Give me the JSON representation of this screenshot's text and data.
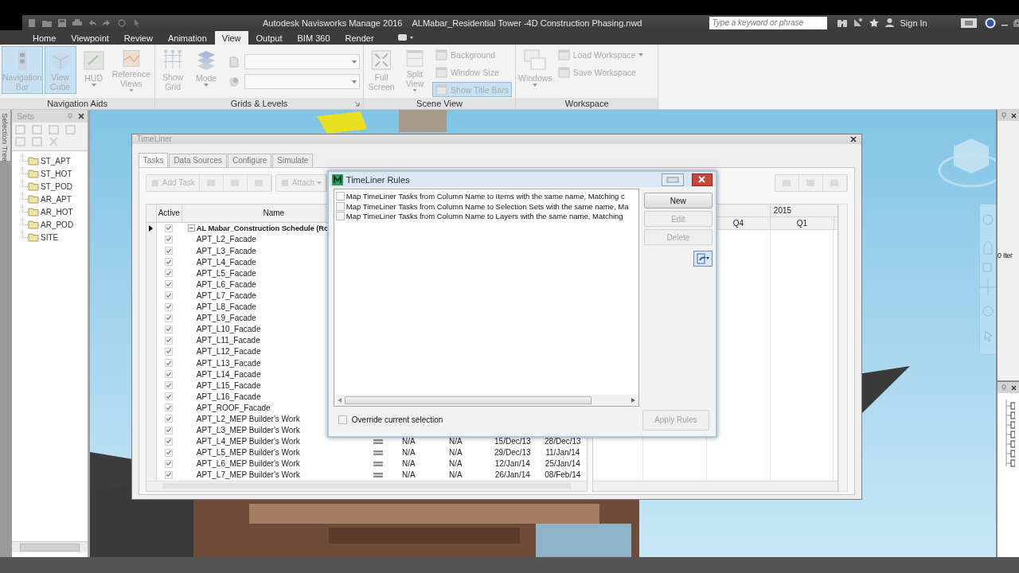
{
  "app": {
    "title": "Autodesk Navisworks Manage 2016",
    "document": "ALMabar_Residential Tower -4D Construction Phasing.nwd",
    "search": {
      "placeholder": "Type a keyword or phrase"
    },
    "sign_in": "Sign In"
  },
  "ribbon_tabs": [
    {
      "label": "Home",
      "selected": false
    },
    {
      "label": "Viewpoint",
      "selected": false
    },
    {
      "label": "Review",
      "selected": false
    },
    {
      "label": "Animation",
      "selected": false
    },
    {
      "label": "View",
      "selected": true
    },
    {
      "label": "Output",
      "selected": false
    },
    {
      "label": "BIM 360",
      "selected": false
    },
    {
      "label": "Render",
      "selected": false
    }
  ],
  "ribbon": {
    "disabled": true,
    "groups": [
      {
        "label": "Navigation Aids",
        "launcher": false,
        "items": [
          {
            "kind": "large",
            "label": "Navigation Bar",
            "on": true,
            "dropdown": false
          },
          {
            "kind": "large",
            "label": "View Cube",
            "on": true,
            "dropdown": false
          },
          {
            "kind": "large",
            "label": "HUD",
            "on": false,
            "dropdown": true
          },
          {
            "kind": "large",
            "label": "Reference Views",
            "on": false,
            "dropdown": true
          }
        ]
      },
      {
        "label": "Grids & Levels",
        "launcher": true,
        "items": [
          {
            "kind": "large",
            "label": "Show Grid",
            "on": false,
            "dropdown": false
          },
          {
            "kind": "large",
            "label": "Mode",
            "on": false,
            "dropdown": true
          },
          {
            "kind": "combos"
          }
        ]
      },
      {
        "label": "Scene View",
        "launcher": false,
        "items": [
          {
            "kind": "large",
            "label": "Full Screen",
            "on": false,
            "dropdown": false
          },
          {
            "kind": "large",
            "label": "Split View",
            "on": false,
            "dropdown": true
          },
          {
            "kind": "stack",
            "items": [
              {
                "label": "Background",
                "on": false,
                "dropdown": false
              },
              {
                "label": "Window Size",
                "on": false,
                "dropdown": false
              },
              {
                "label": "Show Title Bars",
                "on": true,
                "dropdown": false
              }
            ]
          }
        ]
      },
      {
        "label": "Workspace",
        "launcher": false,
        "items": [
          {
            "kind": "large",
            "label": "Windows",
            "on": false,
            "dropdown": true
          },
          {
            "kind": "stack",
            "items": [
              {
                "label": "Load Workspace",
                "on": false,
                "dropdown": true
              },
              {
                "label": "Save Workspace",
                "on": false,
                "dropdown": false
              }
            ]
          }
        ]
      }
    ]
  },
  "sets_panel": {
    "tab": "Selection Tree",
    "title": "Sets",
    "items": [
      "ST_APT",
      "ST_HOT",
      "ST_POD",
      "AR_APT",
      "AR_HOT",
      "AR_POD",
      "SITE"
    ]
  },
  "timeliner": {
    "title": "TimeLiner",
    "tabs": [
      {
        "label": "Tasks",
        "selected": true
      },
      {
        "label": "Data Sources",
        "selected": false
      },
      {
        "label": "Configure",
        "selected": false
      },
      {
        "label": "Simulate",
        "selected": false
      }
    ],
    "toolbar": [
      {
        "label": "Add Task",
        "disabled": true
      },
      {
        "label": "Attach",
        "disabled": true
      }
    ],
    "columns": [
      "Active",
      "Name"
    ],
    "rows": [
      {
        "kind": "group",
        "name": "AL Mabar_Construction Schedule (Ro",
        "active": true,
        "selected": true,
        "expanded": true
      },
      {
        "kind": "task",
        "name": "APT_L2_Facade",
        "active": true,
        "selected": false
      },
      {
        "kind": "task",
        "name": "APT_L3_Facade",
        "active": true,
        "selected": false
      },
      {
        "kind": "task",
        "name": "APT_L4_Facade",
        "active": true,
        "selected": false
      },
      {
        "kind": "task",
        "name": "APT_L5_Facade",
        "active": true,
        "selected": false
      },
      {
        "kind": "task",
        "name": "APT_L6_Facade",
        "active": true,
        "selected": false
      },
      {
        "kind": "task",
        "name": "APT_L7_Facade",
        "active": true,
        "selected": false
      },
      {
        "kind": "task",
        "name": "APT_L8_Facade",
        "active": true,
        "selected": false
      },
      {
        "kind": "task",
        "name": "APT_L9_Facade",
        "active": true,
        "selected": false
      },
      {
        "kind": "task",
        "name": "APT_L10_Facade",
        "active": true,
        "selected": false
      },
      {
        "kind": "task",
        "name": "APT_L11_Facade",
        "active": true,
        "selected": false
      },
      {
        "kind": "task",
        "name": "APT_L12_Facade",
        "active": true,
        "selected": false
      },
      {
        "kind": "task",
        "name": "APT_L13_Facade",
        "active": true,
        "selected": false
      },
      {
        "kind": "task",
        "name": "APT_L14_Facade",
        "active": true,
        "selected": false
      },
      {
        "kind": "task",
        "name": "APT_L15_Facade",
        "active": true,
        "selected": false
      },
      {
        "kind": "task",
        "name": "APT_L16_Facade",
        "active": true,
        "selected": false
      },
      {
        "kind": "task",
        "name": "APT_ROOF_Facade",
        "active": true,
        "selected": false
      },
      {
        "kind": "task",
        "name": "APT_L2_MEP Builder's Work",
        "active": true,
        "selected": false
      },
      {
        "kind": "task",
        "name": "APT_L3_MEP Builder's Work",
        "active": true,
        "selected": false
      },
      {
        "kind": "task",
        "name": "APT_L4_MEP Builder's Work",
        "active": true,
        "selected": false,
        "cells": [
          "N/A",
          "N/A",
          "15/Dec/13",
          "28/Dec/13"
        ]
      },
      {
        "kind": "task",
        "name": "APT_L5_MEP Builder's Work",
        "active": true,
        "selected": false,
        "cells": [
          "N/A",
          "N/A",
          "29/Dec/13",
          "11/Jan/14"
        ]
      },
      {
        "kind": "task",
        "name": "APT_L6_MEP Builder's Work",
        "active": true,
        "selected": false,
        "cells": [
          "N/A",
          "N/A",
          "12/Jan/14",
          "25/Jan/14"
        ]
      },
      {
        "kind": "task",
        "name": "APT_L7_MEP Builder's Work",
        "active": true,
        "selected": false,
        "cells": [
          "N/A",
          "N/A",
          "26/Jan/14",
          "08/Feb/14"
        ]
      }
    ],
    "gantt": {
      "year": "2015",
      "quarters": [
        "Q4",
        "Q1"
      ]
    }
  },
  "rules_dialog": {
    "title": "TimeLiner Rules",
    "rules": [
      {
        "text": "Map TimeLiner Tasks from Column Name to Items with the same name, Matching c",
        "checked": false
      },
      {
        "text": "Map TimeLiner Tasks from Column Name to Selection Sets with the same name, Ma",
        "checked": false
      },
      {
        "text": "Map TimeLiner Tasks from Column Name to Layers with the same name, Matching",
        "checked": false
      }
    ],
    "buttons": [
      {
        "label": "New",
        "disabled": false
      },
      {
        "label": "Edit",
        "disabled": true
      },
      {
        "label": "Delete",
        "disabled": true
      }
    ],
    "override": {
      "label": "Override current selection",
      "checked": false
    },
    "apply": {
      "label": "Apply Rules",
      "disabled": true
    }
  },
  "properties_panel": {
    "text": "0 Iter"
  }
}
